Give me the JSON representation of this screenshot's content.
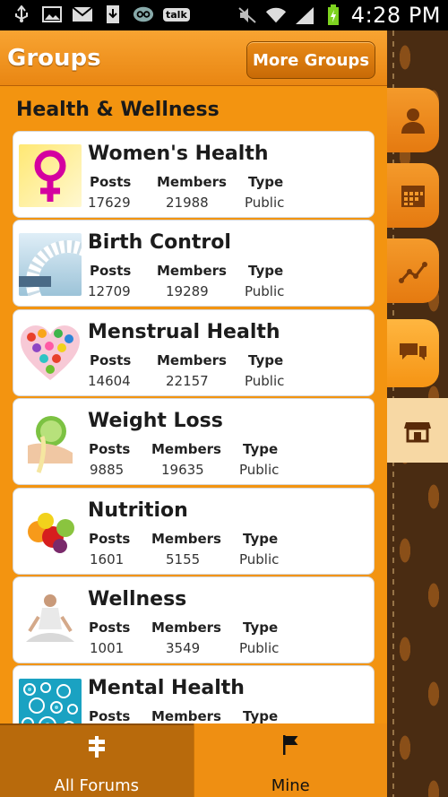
{
  "status_bar": {
    "time": "4:28 PM",
    "icons": [
      "usb-icon",
      "image-icon",
      "gmail-icon",
      "download-icon",
      "voicemail-icon",
      "talk-icon",
      "mute-icon",
      "wifi-icon",
      "signal-icon",
      "battery-charging-icon"
    ],
    "talk_label": "talk"
  },
  "header": {
    "title": "Groups",
    "more_button": "More Groups"
  },
  "section": {
    "title": "Health & Wellness"
  },
  "column_labels": {
    "posts": "Posts",
    "members": "Members",
    "type": "Type"
  },
  "groups": [
    {
      "name": "Women's Health",
      "posts": "17629",
      "members": "21988",
      "type": "Public"
    },
    {
      "name": "Birth Control",
      "posts": "12709",
      "members": "19289",
      "type": "Public"
    },
    {
      "name": "Menstrual Health",
      "posts": "14604",
      "members": "22157",
      "type": "Public"
    },
    {
      "name": "Weight Loss",
      "posts": "9885",
      "members": "19635",
      "type": "Public"
    },
    {
      "name": "Nutrition",
      "posts": "1601",
      "members": "5155",
      "type": "Public"
    },
    {
      "name": "Wellness",
      "posts": "1001",
      "members": "3549",
      "type": "Public"
    },
    {
      "name": "Mental Health",
      "posts": "",
      "members": "",
      "type": ""
    }
  ],
  "side_tabs": [
    "profile-icon",
    "calendar-icon",
    "chart-icon",
    "chat-icon",
    "store-icon"
  ],
  "bottom_tabs": {
    "all_forums": "All Forums",
    "mine": "Mine"
  },
  "colors": {
    "accent": "#f39410",
    "dark_accent": "#b86a0c",
    "panel_brown": "#4a2c12"
  }
}
